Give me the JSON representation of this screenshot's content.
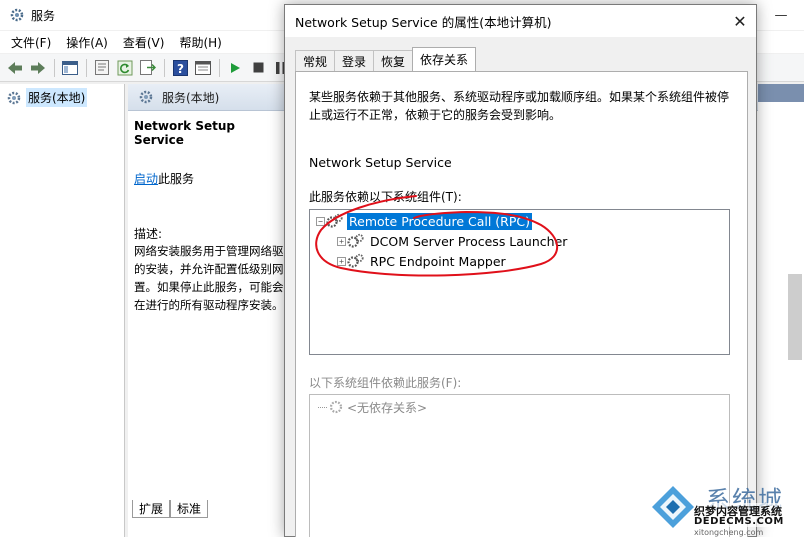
{
  "services_window": {
    "title": "服务",
    "menu": [
      "文件(F)",
      "操作(A)",
      "查看(V)",
      "帮助(H)"
    ],
    "tree_root": "服务(本地)",
    "panel_header": "服务(本地)",
    "service_name": "Network Setup Service",
    "start_link": "启动",
    "start_suffix": "此服务",
    "description_label": "描述:",
    "description_text": "网络安装服务用于管理网络驱\n的安装，并允许配置低级别网\n置。如果停止此服务，可能会\n在进行的所有驱动程序安装。",
    "bottom_tabs": [
      "扩展",
      "标准"
    ]
  },
  "dialog": {
    "title": "Network Setup Service 的属性(本地计算机)",
    "tabs": [
      "常规",
      "登录",
      "恢复",
      "依存关系"
    ],
    "active_tab": "依存关系",
    "intro": "某些服务依赖于其他服务、系统驱动程序或加载顺序组。如果某个系统组件被停止或运行不正常，依赖于它的服务会受到影响。",
    "service_display_name": "Network Setup Service",
    "depends_on_label": "此服务依赖以下系统组件(T):",
    "depends_on": {
      "root": "Remote Procedure Call (RPC)",
      "children": [
        "DCOM Server Process Launcher",
        "RPC Endpoint Mapper"
      ]
    },
    "dependents_label": "以下系统组件依赖此服务(F):",
    "dependents_none": "<无依存关系>"
  },
  "watermark": {
    "main": "系统城",
    "sub": "织梦内容管理系统",
    "domain": "DEDECMS.COM",
    "url": "xitongcheng.com"
  },
  "colors": {
    "selection": "#0078d7",
    "link": "#0066cc",
    "annotation": "#e0101a",
    "panel_header": "#d5dfeb"
  }
}
